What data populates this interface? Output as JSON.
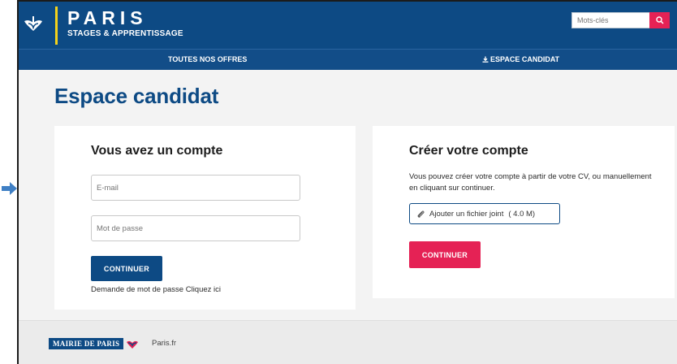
{
  "header": {
    "brand_title": "PARIS",
    "brand_subtitle": "STAGES & APPRENTISSAGE",
    "search_placeholder": "Mots-clés"
  },
  "nav": {
    "offres_label": "TOUTES NOS OFFRES",
    "candidat_label": "ESPACE CANDIDAT"
  },
  "page": {
    "title": "Espace candidat"
  },
  "login": {
    "title": "Vous avez un compte",
    "email_placeholder": "E-mail",
    "password_placeholder": "Mot de passe",
    "continue_label": "CONTINUER",
    "forgot_text": "Demande de mot de passe",
    "forgot_link": "Cliquez ici"
  },
  "create": {
    "title": "Créer votre compte",
    "description": "Vous pouvez créer votre compte à partir de votre CV, ou manuellement en cliquant sur continuer.",
    "attach_label": "Ajouter un fichier joint",
    "attach_size": "( 4.0 M)",
    "continue_label": "CONTINUER"
  },
  "footer": {
    "mairie_label": "MAIRIE DE PARIS",
    "paris_fr": "Paris.fr"
  },
  "colors": {
    "primary_blue": "#0d4a84",
    "accent_pink": "#e52255",
    "accent_yellow": "#f4d21b"
  },
  "icons": [
    "paris-ship-icon",
    "search-icon",
    "download-icon",
    "paperclip-icon",
    "side-arrow-icon"
  ]
}
